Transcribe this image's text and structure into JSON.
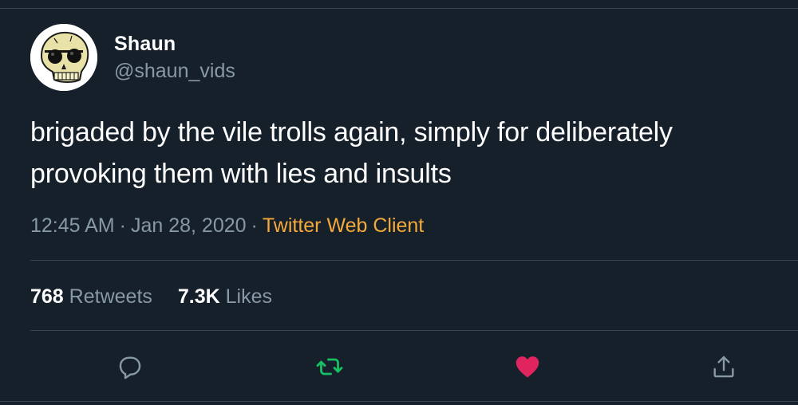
{
  "tweet": {
    "display_name": "Shaun",
    "handle": "@shaun_vids",
    "text": "brigaded by the vile trolls again, simply for deliberately provoking them with lies and insults",
    "time": "12:45 AM",
    "date": "Jan 28, 2020",
    "separator": "·",
    "source": "Twitter Web Client",
    "retweets_count": "768",
    "retweets_label": "Retweets",
    "likes_count": "7.3K",
    "likes_label": "Likes"
  },
  "avatar": {
    "icon": "skull-with-sunglasses-avatar"
  },
  "actions": {
    "reply_icon": "reply-icon",
    "retweet_icon": "retweet-icon",
    "like_icon": "heart-icon",
    "share_icon": "share-icon"
  },
  "colors": {
    "background": "#15202b",
    "secondary_text": "#8899a6",
    "source_link": "#f5a93a",
    "retweet_active": "#17bf63",
    "like_active": "#e0245e",
    "divider": "#38444d"
  }
}
